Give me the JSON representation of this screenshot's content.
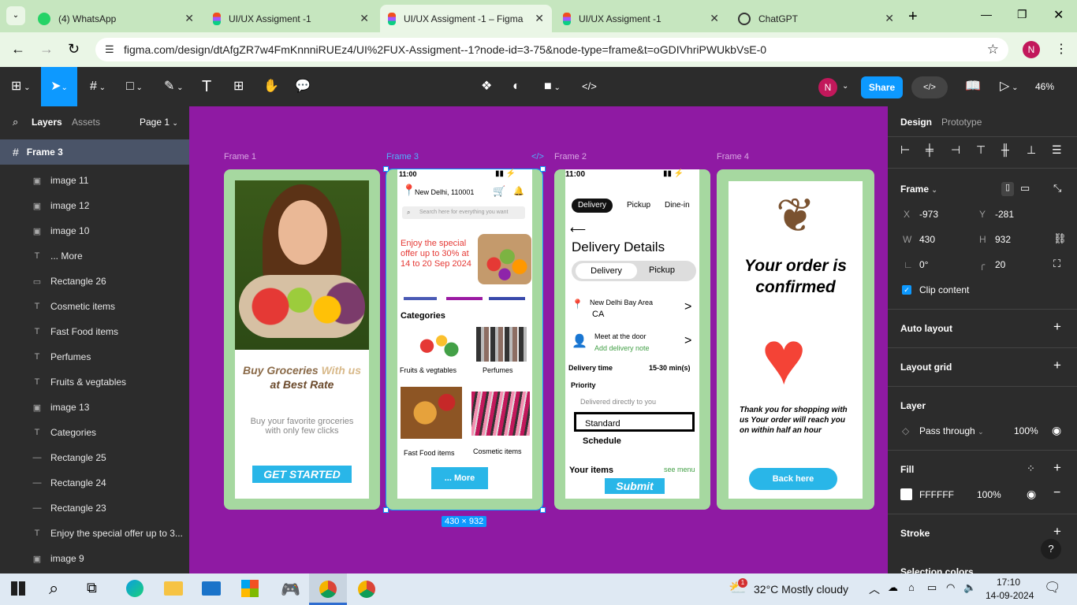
{
  "browser": {
    "tabs": [
      {
        "label": "(4) WhatsApp",
        "icon": "whatsapp-icon"
      },
      {
        "label": "UI/UX Assigment -1",
        "icon": "figma-icon"
      },
      {
        "label": "UI/UX Assigment -1 – Figma",
        "icon": "figma-icon",
        "active": true
      },
      {
        "label": "UI/UX Assigment -1",
        "icon": "figma-icon"
      },
      {
        "label": "ChatGPT",
        "icon": "chatgpt-icon"
      }
    ],
    "url": "figma.com/design/dtAfgZR7w4FmKnnniRUEz4/UI%2FUX-Assigment--1?node-id=3-75&node-type=frame&t=oGDIVhriPWUkbVsE-0",
    "profile": "N"
  },
  "figma": {
    "user_avatar": "N",
    "share": "Share",
    "zoom": "46%",
    "left": {
      "tab_layers": "Layers",
      "tab_assets": "Assets",
      "page": "Page 1",
      "selected": "Frame 3",
      "layers": [
        {
          "icon": "image-icon",
          "label": "image 11"
        },
        {
          "icon": "image-icon",
          "label": "image 12"
        },
        {
          "icon": "image-icon",
          "label": "image 10"
        },
        {
          "icon": "text-icon",
          "label": "... More"
        },
        {
          "icon": "rectangle-icon",
          "label": "Rectangle 26"
        },
        {
          "icon": "text-icon",
          "label": "Cosmetic items"
        },
        {
          "icon": "text-icon",
          "label": "Fast Food items"
        },
        {
          "icon": "text-icon",
          "label": "Perfumes"
        },
        {
          "icon": "text-icon",
          "label": "Fruits & vegtables"
        },
        {
          "icon": "image-icon",
          "label": "image 13"
        },
        {
          "icon": "text-icon",
          "label": "Categories"
        },
        {
          "icon": "line-icon",
          "label": "Rectangle 25"
        },
        {
          "icon": "line-icon",
          "label": "Rectangle 24"
        },
        {
          "icon": "line-icon",
          "label": "Rectangle 23"
        },
        {
          "icon": "text-icon",
          "label": "Enjoy the special offer up to 3..."
        },
        {
          "icon": "image-icon",
          "label": "image 9"
        }
      ]
    },
    "canvas": {
      "frame1": {
        "label": "Frame 1",
        "title1": "Buy Groceries ",
        "title2": "With us",
        "title3": "at Best Rate",
        "sub": "Buy your favorite groceries with only few clicks",
        "cta": "GET STARTED"
      },
      "frame3": {
        "label": "Frame 3",
        "time": "11:00",
        "location": "New Delhi, 110001",
        "search": "Search here for everything you want",
        "offer": "Enjoy the special offer up to 30% at 14 to 20 Sep 2024",
        "categories": "Categories",
        "cat1": "Fruits & vegtables",
        "cat2": "Perfumes",
        "cat3": "Fast Food items",
        "cat4": "Cosmetic items",
        "more": "... More",
        "size": "430 × 932"
      },
      "frame2": {
        "label": "Frame 2",
        "time": "11:00",
        "tab1": "Delivery",
        "tab2": "Pickup",
        "tab3": "Dine-in",
        "title": "Delivery Details",
        "seg1": "Delivery",
        "seg2": "Pickup",
        "addr1": "New Delhi Bay Area",
        "addr2": "CA",
        "meet": "Meet at the door",
        "note": "Add delivery note",
        "dtime": "Delivery time",
        "dtime_val": "15-30 min(s)",
        "priority": "Priority",
        "delivered": "Delivered directly to you",
        "standard": "Standard",
        "schedule": "Schedule",
        "your_items": "Your items",
        "see_menu": "see menu",
        "submit": "Submit"
      },
      "frame4": {
        "label": "Frame 4",
        "title": "Your order is confirmed",
        "msg": "Thank you for shopping with us Your order will reach you on within half an hour",
        "back": "Back here"
      }
    },
    "right": {
      "tab_design": "Design",
      "tab_prototype": "Prototype",
      "frame": "Frame",
      "x_label": "X",
      "x": "-973",
      "y_label": "Y",
      "y": "-281",
      "w_label": "W",
      "w": "430",
      "h_label": "H",
      "h": "932",
      "rotation": "0°",
      "radius": "20",
      "clip": "Clip content",
      "auto_layout": "Auto layout",
      "layout_grid": "Layout grid",
      "layer": "Layer",
      "blend": "Pass through",
      "opacity": "100%",
      "fill": "Fill",
      "fill_hex": "FFFFFF",
      "fill_opacity": "100%",
      "stroke": "Stroke",
      "selection_colors": "Selection colors"
    }
  },
  "taskbar": {
    "weather": "32°C  Mostly cloudy",
    "time": "17:10",
    "date": "14-09-2024",
    "weather_badge": "1"
  },
  "colors": {
    "canvas": "#8f1aa3",
    "frame_green": "#a6d8a0",
    "figma_blue": "#0d99ff",
    "cta_blue": "#29b6e8"
  }
}
